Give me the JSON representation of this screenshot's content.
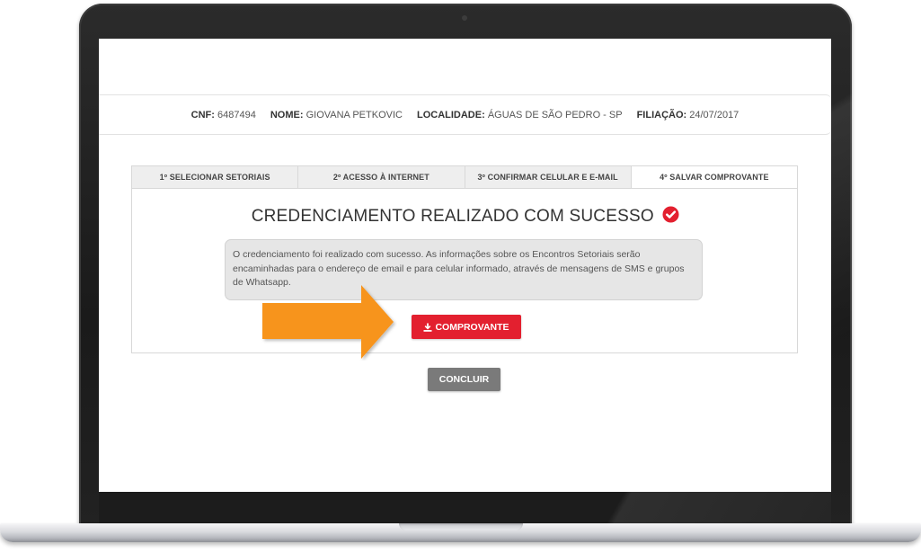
{
  "info": {
    "cnf_label": "CNF:",
    "cnf_value": "6487494",
    "nome_label": "NOME:",
    "nome_value": "GIOVANA PETKOVIC",
    "localidade_label": "LOCALIDADE:",
    "localidade_value": "ÁGUAS DE SÃO PEDRO - SP",
    "filiacao_label": "FILIAÇÃO:",
    "filiacao_value": "24/07/2017"
  },
  "tabs": [
    {
      "label": "1º SELECIONAR SETORIAIS"
    },
    {
      "label": "2º ACESSO À INTERNET"
    },
    {
      "label": "3º CONFIRMAR CELULAR E E-MAIL"
    },
    {
      "label": "4º SALVAR COMPROVANTE"
    }
  ],
  "panel": {
    "title": "CREDENCIAMENTO REALIZADO COM SUCESSO",
    "message": "O credenciamento foi realizado com sucesso. As informações sobre os Encontros Setoriais serão encaminhadas para o endereço de email e para celular informado, através de mensagens de SMS e grupos de Whatsapp.",
    "download_button": "COMPROVANTE"
  },
  "actions": {
    "concluir_button": "CONCLUIR"
  },
  "colors": {
    "accent_red": "#e3202f",
    "arrow_orange": "#f7941d",
    "neutral_button": "#7a7a7a"
  },
  "icons": {
    "success": "check-circle-icon",
    "download": "download-icon",
    "pointer": "arrow-right-icon"
  }
}
